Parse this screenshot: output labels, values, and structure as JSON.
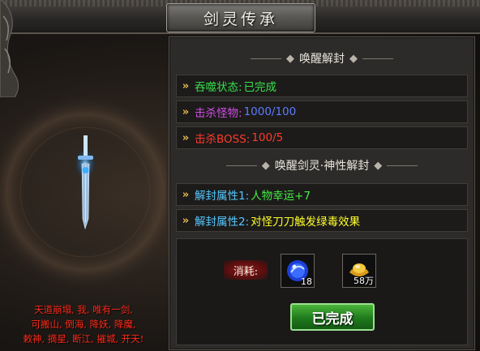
{
  "window": {
    "title": "剑灵传承"
  },
  "awaken": {
    "header": "唤醒解封",
    "rows": [
      {
        "label": "吞噬状态:",
        "value": "已完成",
        "label_color": "#38e04a",
        "value_color": "#38e04a"
      },
      {
        "label": "击杀怪物:",
        "value": "1000/100",
        "label_color": "#d24ee8",
        "value_color": "#5d7cff"
      },
      {
        "label": "击杀BOSS:",
        "value": "100/5",
        "label_color": "#ff3a2a",
        "value_color": "#ff3a2a"
      }
    ]
  },
  "divine": {
    "header": "唤醒剑灵·神性解封",
    "rows": [
      {
        "label": "解封属性1:",
        "value": "人物幸运+7",
        "label_color": "#56c8ff",
        "value_color": "#44ee44"
      },
      {
        "label": "解封属性2:",
        "value": "对怪刀刀触发绿毒效果",
        "label_color": "#56c8ff",
        "value_color": "#ffff2a"
      }
    ]
  },
  "cost": {
    "label": "消耗:",
    "items": [
      {
        "icon": "blue-orb-icon",
        "qty": "18"
      },
      {
        "icon": "gold-ingot-icon",
        "qty": "58万"
      }
    ],
    "button": "已完成"
  },
  "lore": {
    "lines": [
      "天道崩塌, 我, 唯有一剑,",
      "可搬山, 倒海, 降妖, 降魔,",
      "敕神, 摘星, 断江, 摧城, 开天!"
    ]
  }
}
